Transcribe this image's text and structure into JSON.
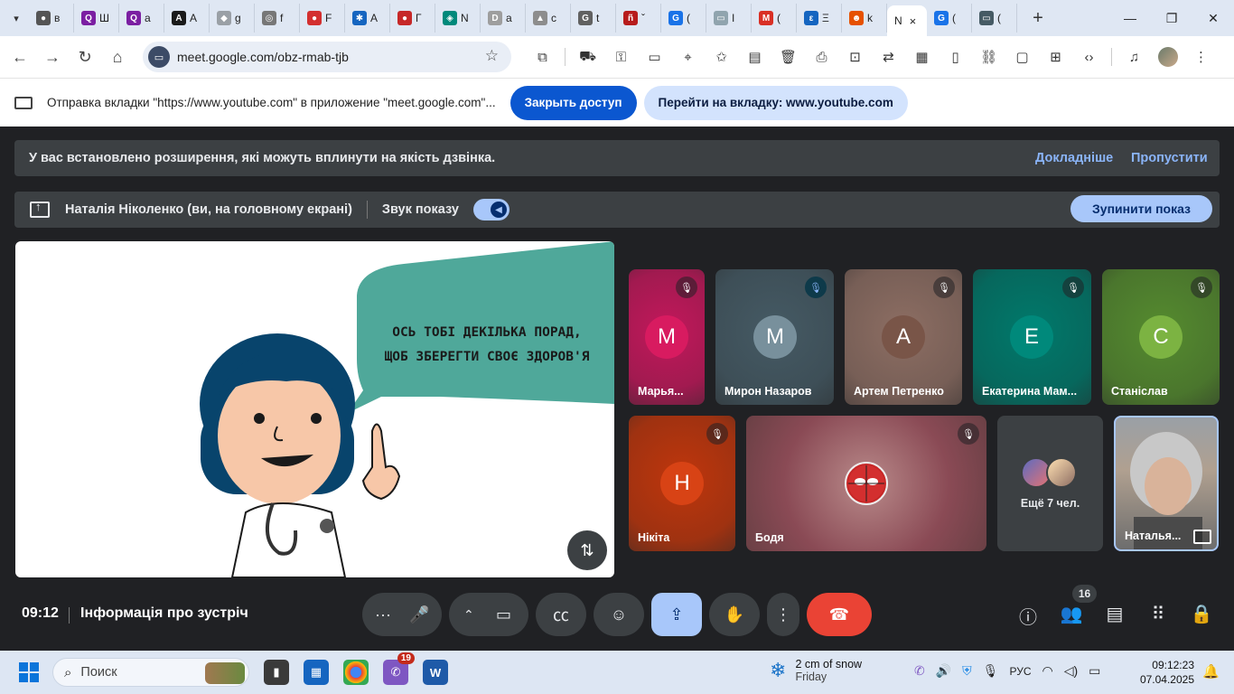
{
  "browser": {
    "tabs": [
      {
        "label": "в",
        "fav": "●",
        "color": "#555555"
      },
      {
        "label": "Ш",
        "fav": "Q",
        "color": "#7b1fa2"
      },
      {
        "label": "а",
        "fav": "Q",
        "color": "#7b1fa2"
      },
      {
        "label": "А",
        "fav": "A",
        "color": "#1a1a1a"
      },
      {
        "label": "g",
        "fav": "◆",
        "color": "#9aa0a6"
      },
      {
        "label": "f",
        "fav": "◎",
        "color": "#777777"
      },
      {
        "label": "F",
        "fav": "●",
        "color": "#d32f2f"
      },
      {
        "label": "А",
        "fav": "✱",
        "color": "#1565c0"
      },
      {
        "label": "Г",
        "fav": "●",
        "color": "#c62828"
      },
      {
        "label": "N",
        "fav": "◈",
        "color": "#00897b"
      },
      {
        "label": "а",
        "fav": "D",
        "color": "#9e9e9e"
      },
      {
        "label": "c",
        "fav": "▲",
        "color": "#8d8d8d"
      },
      {
        "label": "t",
        "fav": "G",
        "color": "#616161"
      },
      {
        "label": "ˇ",
        "fav": "ñ",
        "color": "#b71c1c"
      },
      {
        "label": "(",
        "fav": "G",
        "color": "#1a73e8"
      },
      {
        "label": "I",
        "fav": "▭",
        "color": "#90a4ae"
      },
      {
        "label": "(",
        "fav": "M",
        "color": "#d93025"
      },
      {
        "label": "Ξ",
        "fav": "ε",
        "color": "#1565c0"
      },
      {
        "label": "k",
        "fav": "☻",
        "color": "#e65100"
      }
    ],
    "active_tab": {
      "label": "N",
      "close": "×"
    },
    "tabs_after": [
      {
        "label": "(",
        "fav": "G",
        "color": "#1a73e8"
      },
      {
        "label": "(",
        "fav": "▭",
        "color": "#455a64"
      }
    ],
    "new_tab": "+",
    "url": "meet.google.com/obz-rmab-tjb",
    "infobar": {
      "text": "Отправка вкладки \"https://www.youtube.com\" в приложение \"meet.google.com\"...",
      "close_access": "Закрыть доступ",
      "go_to_tab": "Перейти на вкладку: www.youtube.com"
    }
  },
  "meet": {
    "warning": {
      "text": "У вас встановлено розширення, які можуть вплинути на якість дзвінка.",
      "learn_more": "Докладніше",
      "skip": "Пропустити"
    },
    "presenting": {
      "name": "Наталія Ніколенко (ви, на головному екрані)",
      "sound_label": "Звук показу",
      "stop": "Зупинити показ"
    },
    "slide": {
      "line1": "ОСЬ ТОБІ ДЕКІЛЬКА ПОРАД,",
      "line2": "ЩОБ ЗБЕРЕГТИ СВОЄ ЗДОРОВ'Я"
    },
    "participants": [
      {
        "name": "Марья...",
        "initial": "M",
        "bg": "#c2185b",
        "circle": "#d81b60"
      },
      {
        "name": "Мирон Назаров",
        "initial": "M",
        "bg": "#455a64",
        "circle": "#78909c"
      },
      {
        "name": "Артем Петренко",
        "initial": "A",
        "bg": "#8d6e63",
        "circle": "#795548"
      },
      {
        "name": "Екатерина Мам...",
        "initial": "E",
        "bg": "#00796b",
        "circle": "#00897b"
      },
      {
        "name": "Станіслав",
        "initial": "C",
        "bg": "#558b2f",
        "circle": "#7cb342"
      },
      {
        "name": "Нікіта",
        "initial": "H",
        "bg": "#bf360c",
        "circle": "#d84315"
      },
      {
        "name": "Бодя",
        "initial": "",
        "bg": "#9a6a6a",
        "circle": ""
      },
      {
        "name": "Наталья...",
        "initial": "",
        "bg": "#8a8a8a",
        "circle": ""
      }
    ],
    "more_people": "Ещё 7 чел.",
    "time": "09:12",
    "meeting_info": "Інформація про зустріч",
    "people_count": "16"
  },
  "taskbar": {
    "search_label": "Поиск",
    "badge": "19",
    "weather_line1": "2 cm of snow",
    "weather_line2": "Friday",
    "lang": "РУС",
    "time": "09:12:23",
    "date": "07.04.2025"
  }
}
